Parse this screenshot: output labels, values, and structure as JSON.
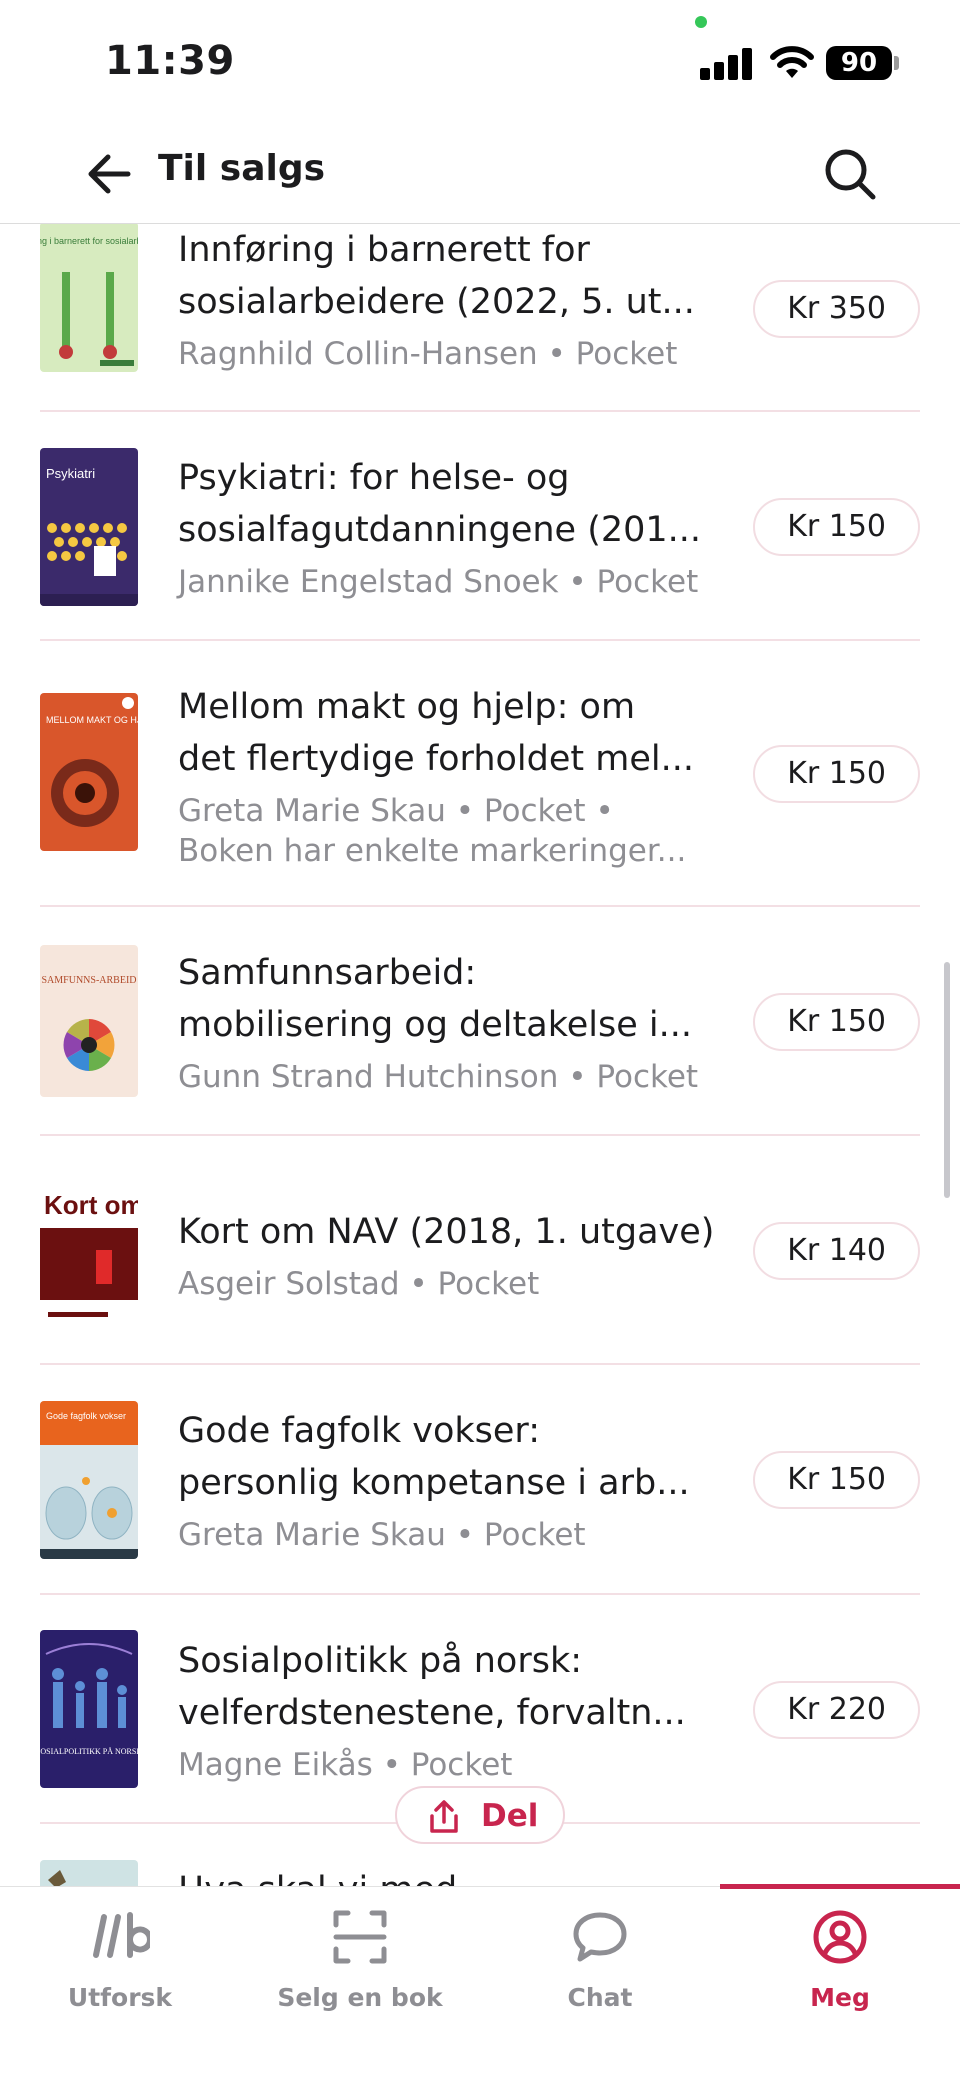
{
  "status_bar": {
    "time": "11:39",
    "battery": "90"
  },
  "header": {
    "title": "Til salgs"
  },
  "listings": [
    {
      "title_line1": "Innføring i barnerett for",
      "title_line2": "sosialarbeidere (2022, 5. ut...",
      "meta_line1": "Ragnhild Collin-Hansen • Pocket",
      "meta_line2": "",
      "price": "Kr 350"
    },
    {
      "title_line1": "Psykiatri: for helse- og",
      "title_line2": "sosialfagutdanningene (201...",
      "meta_line1": "Jannike Engelstad Snoek • Pocket",
      "meta_line2": "",
      "price": "Kr 150"
    },
    {
      "title_line1": "Mellom makt og hjelp: om",
      "title_line2": "det flertydige forholdet mel...",
      "meta_line1": "Greta Marie Skau • Pocket •",
      "meta_line2": "Boken har enkelte markeringer...",
      "price": "Kr 150"
    },
    {
      "title_line1": "Samfunnsarbeid:",
      "title_line2": "mobilisering og deltakelse i...",
      "meta_line1": "Gunn Strand Hutchinson • Pocket",
      "meta_line2": "",
      "price": "Kr 150"
    },
    {
      "title_line1": "Kort om NAV (2018, 1. utgave)",
      "title_line2": "",
      "meta_line1": "Asgeir Solstad • Pocket",
      "meta_line2": "",
      "price": "Kr 140"
    },
    {
      "title_line1": "Gode fagfolk vokser:",
      "title_line2": "personlig kompetanse i arb...",
      "meta_line1": "Greta Marie Skau • Pocket",
      "meta_line2": "",
      "price": "Kr 150"
    },
    {
      "title_line1": "Sosialpolitikk på norsk:",
      "title_line2": "velferdstenestene, forvaltn...",
      "meta_line1": "Magne Eikås • Pocket",
      "meta_line2": "",
      "price": "Kr 220"
    },
    {
      "title_line1": "Hva skal vi med",
      "title_line2": "",
      "meta_line1": "",
      "meta_line2": "",
      "price": ""
    }
  ],
  "covers": {
    "c1": {
      "text": "Innføring i barnerett for sosialarbeidere"
    },
    "c2": {
      "text": "Psykiatri"
    },
    "c3": {
      "text": "MELLOM MAKT OG HJELP"
    },
    "c4": {
      "text": "SAMFUNNS-ARBEID"
    },
    "c5": {
      "text": "Kort om NAV"
    },
    "c6": {
      "text": "Gode fagfolk vokser"
    },
    "c7": {
      "text": "SOSIALPOLITIKK PÅ NORSK"
    }
  },
  "share_button": {
    "label": "Del"
  },
  "tabs": [
    {
      "label": "Utforsk",
      "icon": "explore-icon",
      "active": false
    },
    {
      "label": "Selg en bok",
      "icon": "scan-icon",
      "active": false
    },
    {
      "label": "Chat",
      "icon": "chat-icon",
      "active": false
    },
    {
      "label": "Meg",
      "icon": "profile-icon",
      "active": true
    }
  ],
  "colors": {
    "accent": "#c8254e",
    "muted": "#8e8e93",
    "divider": "#f3dfe4"
  }
}
